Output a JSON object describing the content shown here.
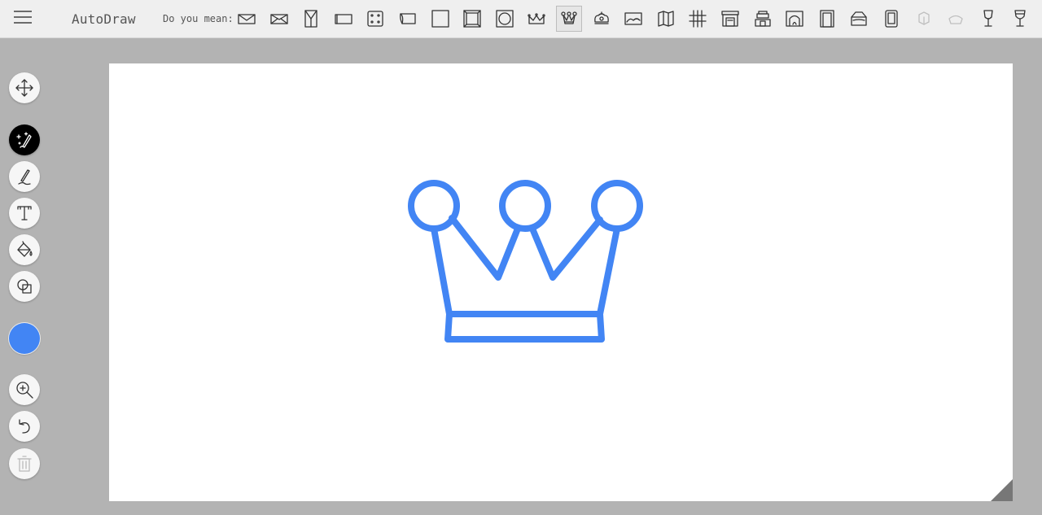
{
  "header": {
    "app_title": "AutoDraw",
    "suggestion_label": "Do you mean:"
  },
  "suggestions": [
    {
      "icon": "envelope-icon"
    },
    {
      "icon": "open-envelope-icon"
    },
    {
      "icon": "book-icon"
    },
    {
      "icon": "rectangle-icon"
    },
    {
      "icon": "dice-icon"
    },
    {
      "icon": "banner-icon"
    },
    {
      "icon": "square-icon"
    },
    {
      "icon": "frame-icon"
    },
    {
      "icon": "circle-frame-icon"
    },
    {
      "icon": "small-crown-icon"
    },
    {
      "icon": "crown-icon",
      "selected": true
    },
    {
      "icon": "royal-crown-icon"
    },
    {
      "icon": "landscape-icon"
    },
    {
      "icon": "map-icon"
    },
    {
      "icon": "hashtag-icon"
    },
    {
      "icon": "fireplace-icon"
    },
    {
      "icon": "pagoda-icon"
    },
    {
      "icon": "arch-fireplace-icon"
    },
    {
      "icon": "doorway-icon"
    },
    {
      "icon": "lamp-shade-icon"
    },
    {
      "icon": "phone-icon"
    },
    {
      "icon": "faint-cube-icon",
      "faded": true
    },
    {
      "icon": "faint-bowl-icon",
      "faded": true
    },
    {
      "icon": "wine-glass-icon"
    },
    {
      "icon": "goblet-icon"
    }
  ],
  "tools": [
    {
      "name": "select-tool",
      "icon": "move-arrows-icon"
    },
    {
      "name": "autodraw-tool",
      "icon": "magic-pen-icon",
      "active": true
    },
    {
      "name": "draw-tool",
      "icon": "pen-icon"
    },
    {
      "name": "type-tool",
      "icon": "text-t-icon"
    },
    {
      "name": "fill-tool",
      "icon": "paint-bucket-icon"
    },
    {
      "name": "shape-tool",
      "icon": "shapes-icon"
    },
    {
      "name": "zoom-tool",
      "icon": "magnifier-plus-icon"
    },
    {
      "name": "undo-tool",
      "icon": "undo-arrow-icon"
    },
    {
      "name": "delete-tool",
      "icon": "trash-icon",
      "disabled": true
    }
  ],
  "colors": {
    "selected_color": "#4285f4",
    "topbar_bg": "#efefef",
    "workspace_bg": "#b3b3b3",
    "canvas_bg": "#ffffff"
  },
  "canvas": {
    "drawing": "crown-drawing"
  }
}
